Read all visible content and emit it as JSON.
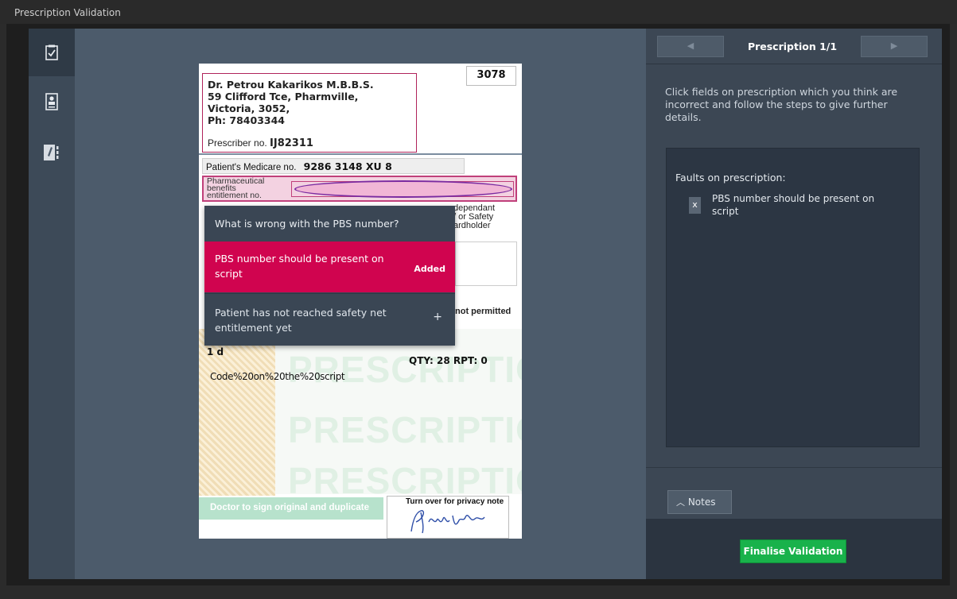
{
  "window": {
    "title": "Prescription Validation"
  },
  "rail": {
    "items": [
      {
        "icon": "checklist-icon",
        "active": true
      },
      {
        "icon": "patient-card-icon",
        "active": false
      },
      {
        "icon": "notes-edit-icon",
        "active": false
      }
    ]
  },
  "prescription": {
    "script_number": "3078",
    "prescriber_line1": "Dr. Petrou Kakarikos M.B.B.S.",
    "prescriber_line2": "59 Clifford Tce, Pharmville,",
    "prescriber_line3": "Victoria, 3052,",
    "prescriber_line4": "Ph: 78403344",
    "prescriber_no_label": "Prescriber no.",
    "prescriber_no": "IJ82311",
    "medicare_label": "Patient's Medicare no.",
    "medicare_no": "9286 3148 XU 8",
    "pbs_label_1": "Pharmaceutical",
    "pbs_label_2": "benefits",
    "pbs_label_3": "entitlement no.",
    "dependant_1": "dependant",
    "dependant_2": "/ or Safety",
    "dependant_3": "ardholder",
    "not_permitted": "not permitted",
    "dose": "1 d",
    "qty": "QTY: 28 RPT: 0",
    "code": "Code%20on%20the%20script",
    "watermark": "PRESCRIPTION",
    "sign_note": "Doctor to sign original and duplicate",
    "privacy_note": "Turn over for privacy note",
    "signature": "PKakarikos"
  },
  "popup": {
    "question": "What is wrong with the PBS number?",
    "options": [
      {
        "label": "PBS number should be present on script",
        "status": "Added"
      },
      {
        "label": "Patient has not reached safety net entitlement yet",
        "status": "+"
      }
    ]
  },
  "panel": {
    "nav_title": "Prescription 1/1",
    "prev_glyph": "◀",
    "next_glyph": "▶",
    "instructions": "Click fields on prescription which you think are incorrect and follow the steps to give further details.",
    "faults_title": "Faults on prescription:",
    "faults": [
      {
        "remove_glyph": "x",
        "text": "PBS number should be present on script"
      }
    ],
    "notes_label": "Notes",
    "finalise_label": "Finalise Validation"
  },
  "colors": {
    "accent": "#d0044f",
    "finalise": "#19b24b",
    "panel": "#3c4754",
    "viewer": "#4c5b6b"
  }
}
